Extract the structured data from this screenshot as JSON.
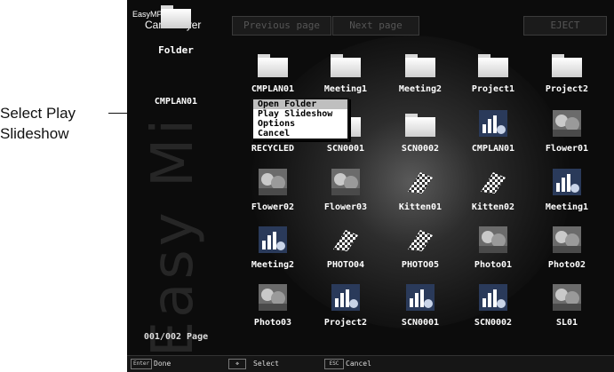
{
  "callout": {
    "line1": "Select Play",
    "line2": "Slideshow"
  },
  "app": {
    "logo_top": "EasyMP",
    "logo_bottom": "Card Player",
    "watermark": "Easy Mi"
  },
  "toolbar": {
    "prev_label": "Previous page",
    "next_label": "Next page",
    "eject_label": "EJECT"
  },
  "left_panel": {
    "title": "Folder",
    "current_folder": "CMPLAN01",
    "page_counter": "001/002 Page"
  },
  "grid": [
    {
      "label": "CMPLAN01",
      "icon": "folder-icon",
      "kind": "folder"
    },
    {
      "label": "Meeting1",
      "icon": "folder-icon",
      "kind": "folder"
    },
    {
      "label": "Meeting2",
      "icon": "folder-icon",
      "kind": "folder"
    },
    {
      "label": "Project1",
      "icon": "folder-icon",
      "kind": "folder"
    },
    {
      "label": "Project2",
      "icon": "folder-icon",
      "kind": "folder"
    },
    {
      "label": "RECYCLED",
      "icon": "folder-icon",
      "kind": "folder"
    },
    {
      "label": "SCN0001",
      "icon": "folder-icon",
      "kind": "folder"
    },
    {
      "label": "SCN0002",
      "icon": "folder-icon",
      "kind": "folder"
    },
    {
      "label": "CMPLAN01",
      "icon": "chart-thumbnail-icon",
      "kind": "chart"
    },
    {
      "label": "Flower01",
      "icon": "flower-thumbnail-icon",
      "kind": "photo"
    },
    {
      "label": "Flower02",
      "icon": "flower-thumbnail-icon",
      "kind": "photo"
    },
    {
      "label": "Flower03",
      "icon": "flower-thumbnail-icon",
      "kind": "photo"
    },
    {
      "label": "Kitten01",
      "icon": "checkered-thumbnail-icon",
      "kind": "checker"
    },
    {
      "label": "Kitten02",
      "icon": "checkered-thumbnail-icon",
      "kind": "checker"
    },
    {
      "label": "Meeting1",
      "icon": "chart-thumbnail-icon",
      "kind": "chart"
    },
    {
      "label": "Meeting2",
      "icon": "chart-thumbnail-icon",
      "kind": "chart"
    },
    {
      "label": "PHOTO04",
      "icon": "checkered-thumbnail-icon",
      "kind": "checker"
    },
    {
      "label": "PHOTO05",
      "icon": "checkered-thumbnail-icon",
      "kind": "checker"
    },
    {
      "label": "Photo01",
      "icon": "photo-thumbnail-icon",
      "kind": "photo"
    },
    {
      "label": "Photo02",
      "icon": "photo-thumbnail-icon",
      "kind": "photo"
    },
    {
      "label": "Photo03",
      "icon": "photo-thumbnail-icon",
      "kind": "photo"
    },
    {
      "label": "Project2",
      "icon": "chart-thumbnail-icon",
      "kind": "chart"
    },
    {
      "label": "SCN0001",
      "icon": "chart-thumbnail-icon",
      "kind": "chart"
    },
    {
      "label": "SCN0002",
      "icon": "chart-thumbnail-icon",
      "kind": "chart"
    },
    {
      "label": "SL01",
      "icon": "photo-thumbnail-icon",
      "kind": "photo"
    }
  ],
  "context_menu": {
    "items": [
      {
        "label": "Open Folder",
        "selected": true
      },
      {
        "label": "Play Slideshow",
        "selected": false
      },
      {
        "label": "Options",
        "selected": false
      },
      {
        "label": "Cancel",
        "selected": false
      }
    ]
  },
  "statusbar": {
    "enter_key": "Enter",
    "enter_label": "Done",
    "select_label": "Select",
    "esc_key": "ESC",
    "esc_label": "Cancel"
  },
  "colors": {
    "background": "#0c0c0c",
    "text": "#ffffff",
    "menu_highlight": "#bfbfbf"
  }
}
